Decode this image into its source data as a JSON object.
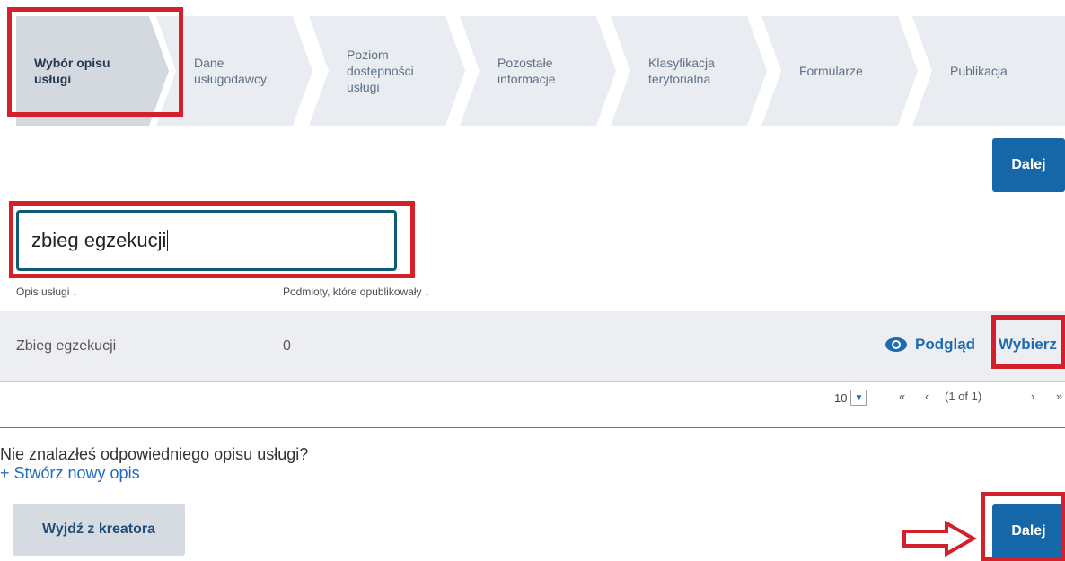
{
  "wizard": {
    "steps": [
      {
        "line1": "Wybór opisu",
        "line2": "usługi",
        "line3": ""
      },
      {
        "line1": "Dane",
        "line2": "usługodawcy",
        "line3": ""
      },
      {
        "line1": "Poziom",
        "line2": "dostępności",
        "line3": "usługi"
      },
      {
        "line1": "Pozostałe",
        "line2": "informacje",
        "line3": ""
      },
      {
        "line1": "Klasyfikacja",
        "line2": "terytorialna",
        "line3": ""
      },
      {
        "line1": "Formularze",
        "line2": "",
        "line3": ""
      },
      {
        "line1": "Publikacja",
        "line2": "",
        "line3": ""
      }
    ]
  },
  "buttons": {
    "next_top": "Dalej",
    "next_bottom": "Dalej",
    "exit": "Wyjdź z kreatora"
  },
  "search": {
    "value": "zbieg egzekucji"
  },
  "table": {
    "headers": [
      "Opis usługi",
      "Podmioty, które opublikowały"
    ],
    "sort_arrow": "↓",
    "rows": [
      {
        "description": "Zbieg egzekucji",
        "count": "0",
        "preview": "Podgląd",
        "select": "Wybierz"
      }
    ]
  },
  "pagination": {
    "rows_per_page": "10",
    "first": "«",
    "prev": "‹",
    "info": "(1 of 1)",
    "next": "›",
    "last": "»"
  },
  "footer": {
    "not_found": "Nie znalazłeś odpowiedniego opisu usługi?",
    "create_link": "+ Stwórz nowy opis"
  },
  "colors": {
    "accent": "#1667a8",
    "highlight": "#d3202c"
  }
}
